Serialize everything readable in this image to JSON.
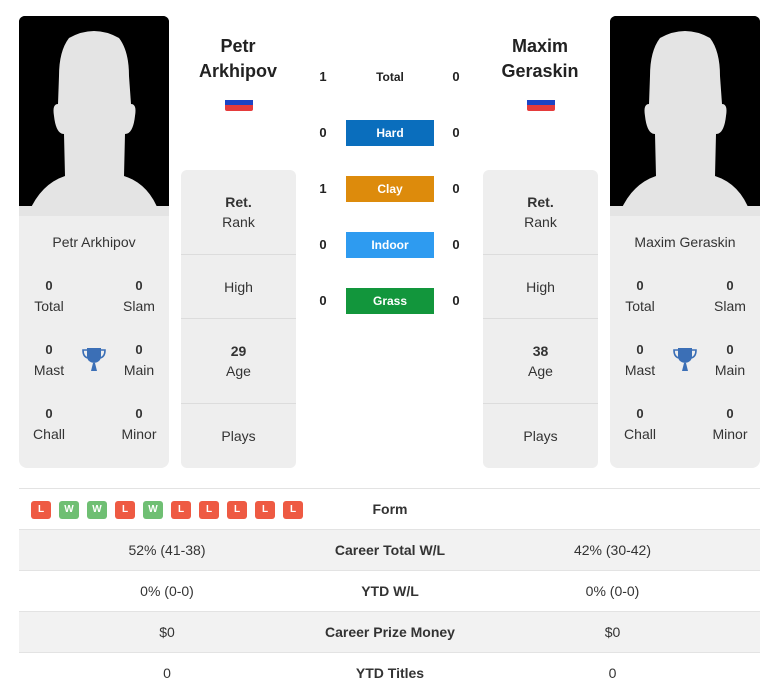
{
  "player1": {
    "name_line1": "Petr",
    "name_line2": "Arkhipov",
    "full_name": "Petr Arkhipov",
    "flag": "russia-flag",
    "titles": {
      "total": {
        "value": "0",
        "label": "Total"
      },
      "slam": {
        "value": "0",
        "label": "Slam"
      },
      "mast": {
        "value": "0",
        "label": "Mast"
      },
      "main": {
        "value": "0",
        "label": "Main"
      },
      "chall": {
        "value": "0",
        "label": "Chall"
      },
      "minor": {
        "value": "0",
        "label": "Minor"
      }
    },
    "info": {
      "rank_value": "Ret.",
      "rank_label": "Rank",
      "high_label": "High",
      "age_value": "29",
      "age_label": "Age",
      "plays_label": "Plays"
    },
    "form": [
      "L",
      "W",
      "W",
      "L",
      "W",
      "L",
      "L",
      "L",
      "L",
      "L"
    ]
  },
  "player2": {
    "name_line1": "Maxim",
    "name_line2": "Geraskin",
    "full_name": "Maxim Geraskin",
    "flag": "russia-flag",
    "titles": {
      "total": {
        "value": "0",
        "label": "Total"
      },
      "slam": {
        "value": "0",
        "label": "Slam"
      },
      "mast": {
        "value": "0",
        "label": "Mast"
      },
      "main": {
        "value": "0",
        "label": "Main"
      },
      "chall": {
        "value": "0",
        "label": "Chall"
      },
      "minor": {
        "value": "0",
        "label": "Minor"
      }
    },
    "info": {
      "rank_value": "Ret.",
      "rank_label": "Rank",
      "high_label": "High",
      "age_value": "38",
      "age_label": "Age",
      "plays_label": "Plays"
    }
  },
  "h2h": [
    {
      "surface": "Total",
      "p1": "1",
      "p2": "0",
      "color": ""
    },
    {
      "surface": "Hard",
      "p1": "0",
      "p2": "0",
      "color": "#0a6ebd"
    },
    {
      "surface": "Clay",
      "p1": "1",
      "p2": "0",
      "color": "#dd8b0c"
    },
    {
      "surface": "Indoor",
      "p1": "0",
      "p2": "0",
      "color": "#2e9bf0"
    },
    {
      "surface": "Grass",
      "p1": "0",
      "p2": "0",
      "color": "#12963c"
    }
  ],
  "colors": {
    "win": "#6fbf73",
    "loss": "#ee5a43",
    "trophy": "#3b6fb6",
    "flag_white": "#ffffff",
    "flag_blue": "#1c44c4",
    "flag_red": "#e53b3b"
  },
  "table": {
    "form_label": "Form",
    "rows": [
      {
        "label": "Career Total W/L",
        "p1": "52% (41-38)",
        "p2": "42% (30-42)"
      },
      {
        "label": "YTD W/L",
        "p1": "0% (0-0)",
        "p2": "0% (0-0)"
      },
      {
        "label": "Career Prize Money",
        "p1": "$0",
        "p2": "$0"
      },
      {
        "label": "YTD Titles",
        "p1": "0",
        "p2": "0"
      }
    ]
  }
}
